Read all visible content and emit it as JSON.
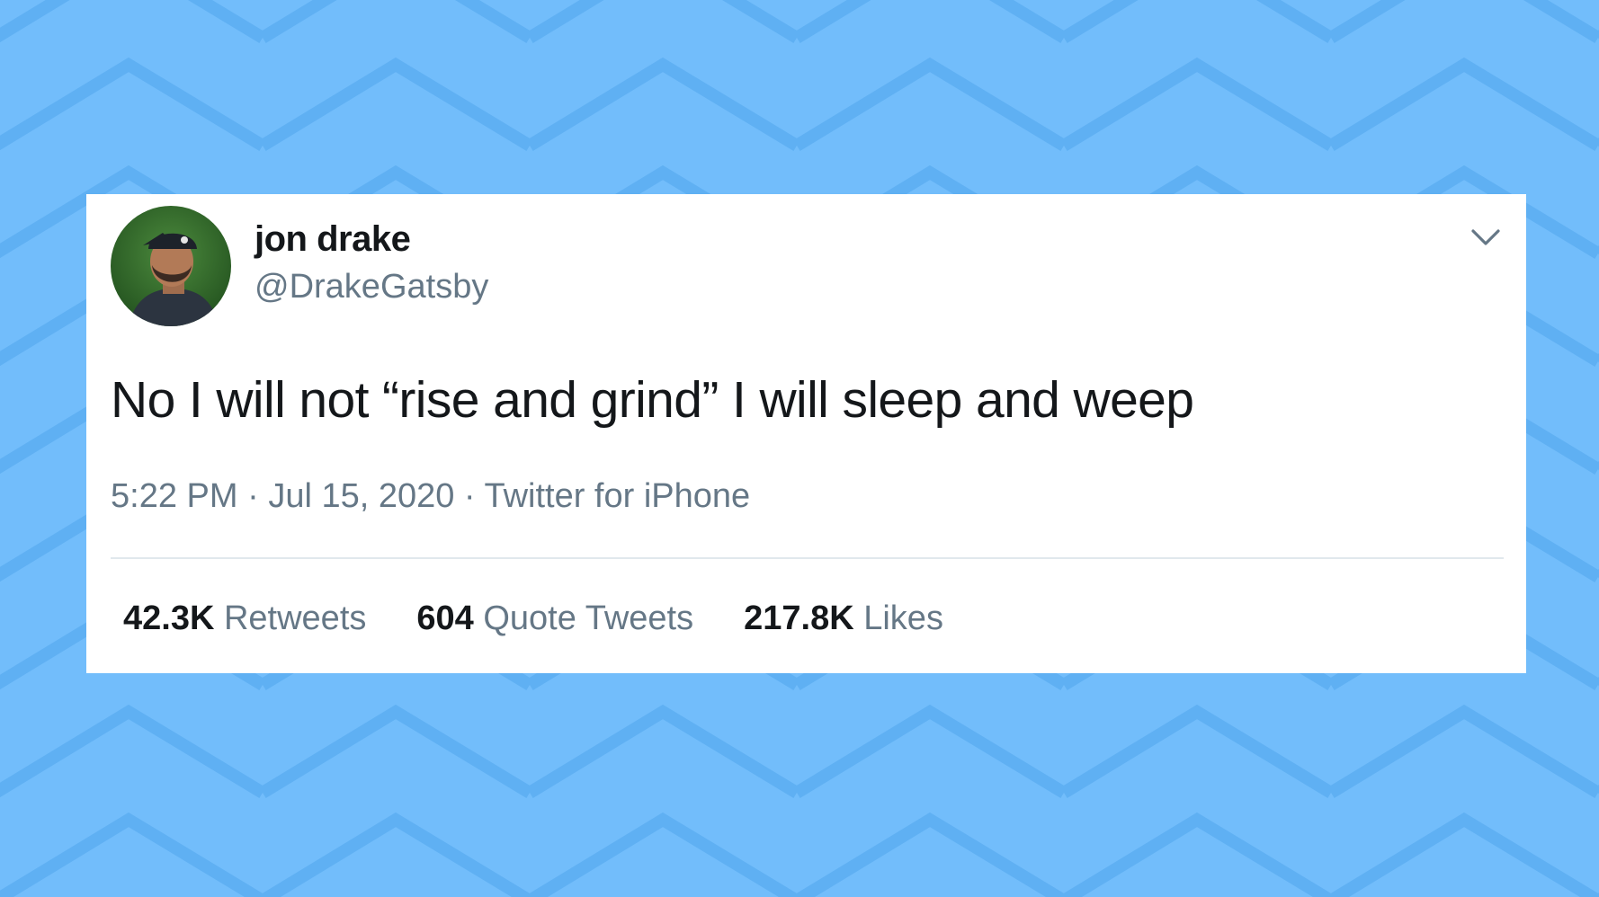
{
  "colors": {
    "background": "#72bdfb",
    "zigzag": "#5fb0f3",
    "card": "#ffffff",
    "text_primary": "#14171a",
    "text_secondary": "#657786",
    "divider": "#e1e8ed",
    "avatar_bg": "#2f6b2a"
  },
  "tweet": {
    "author": {
      "display_name": "jon drake",
      "handle": "@DrakeGatsby",
      "avatar_icon": "user-avatar-photo"
    },
    "menu_icon": "chevron-down-icon",
    "text": "No I will not “rise and grind” I will sleep and weep",
    "meta": {
      "time": "5:22 PM",
      "separator": " · ",
      "date": "Jul 15, 2020",
      "source": "Twitter for iPhone"
    },
    "stats": [
      {
        "count": "42.3K",
        "label": "Retweets"
      },
      {
        "count": "604",
        "label": "Quote Tweets"
      },
      {
        "count": "217.8K",
        "label": "Likes"
      }
    ]
  }
}
